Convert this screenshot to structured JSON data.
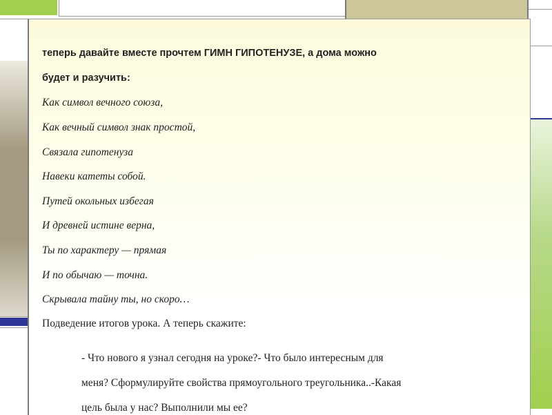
{
  "intro_line1": "теперь давайте вместе прочтем  ГИМН ГИПОТЕНУЗЕ, а дома можно",
  "intro_line2": "будет и разучить:",
  "poem": [
    "Как символ вечного союза,",
    "Как вечный символ знак простой,",
    "Связала гипотенуза",
    "Навеки катеты собой.",
    "Путей окольных избегая",
    "И древней истине верна,",
    "Ты по характеру — прямая",
    "И по обычаю — точна.",
    "Скрывала тайну ты, но скоро…"
  ],
  "summary": "Подведение итогов урока.  А теперь скажите:",
  "questions": [
    "- Что  нового я узнал сегодня на уроке?- Что было интересным для",
    "меня? Сформулируйте свойства прямоугольного треугольника..-Какая",
    "цель была у нас? Выполнили мы ее?"
  ],
  "colors": {
    "green": "#a2cf4e",
    "olive": "#cbc79a",
    "navy": "#2e3796",
    "tan": "#a39a80",
    "card_top": "#fdfbdc"
  }
}
